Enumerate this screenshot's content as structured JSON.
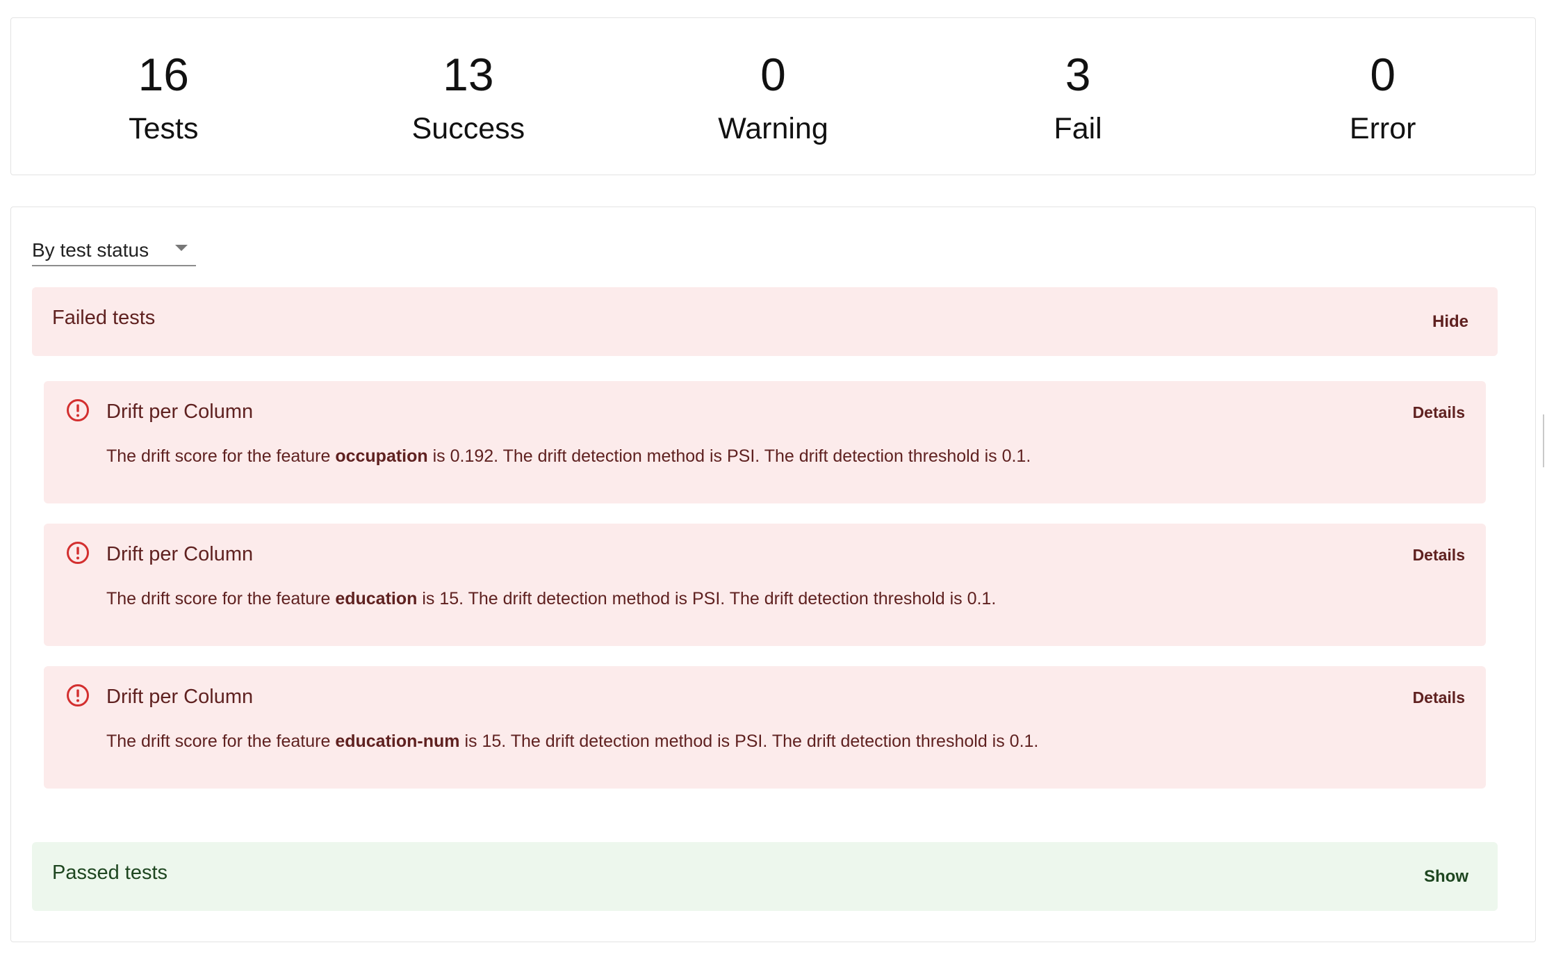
{
  "summary": {
    "stats": [
      {
        "value": "16",
        "label": "Tests"
      },
      {
        "value": "13",
        "label": "Success"
      },
      {
        "value": "0",
        "label": "Warning"
      },
      {
        "value": "3",
        "label": "Fail"
      },
      {
        "value": "0",
        "label": "Error"
      }
    ]
  },
  "grouping": {
    "selected": "By test status",
    "icon": "chevron-down-icon"
  },
  "failed_section": {
    "title": "Failed tests",
    "toggle_label": "Hide",
    "color": "#fcebeb",
    "text_color": "#5f2120",
    "tests": [
      {
        "title": "Drift per Column",
        "details_label": "Details",
        "icon": "error-outline-icon",
        "desc_prefix": "The drift score for the feature ",
        "feature": "occupation",
        "desc_suffix": " is 0.192. The drift detection method is PSI. The drift detection threshold is 0.1."
      },
      {
        "title": "Drift per Column",
        "details_label": "Details",
        "icon": "error-outline-icon",
        "desc_prefix": "The drift score for the feature ",
        "feature": "education",
        "desc_suffix": " is 15. The drift detection method is PSI. The drift detection threshold is 0.1."
      },
      {
        "title": "Drift per Column",
        "details_label": "Details",
        "icon": "error-outline-icon",
        "desc_prefix": "The drift score for the feature ",
        "feature": "education-num",
        "desc_suffix": " is 15. The drift detection method is PSI. The drift detection threshold is 0.1."
      }
    ]
  },
  "passed_section": {
    "title": "Passed tests",
    "toggle_label": "Show",
    "color": "#edf7ed",
    "text_color": "#1e4620"
  }
}
